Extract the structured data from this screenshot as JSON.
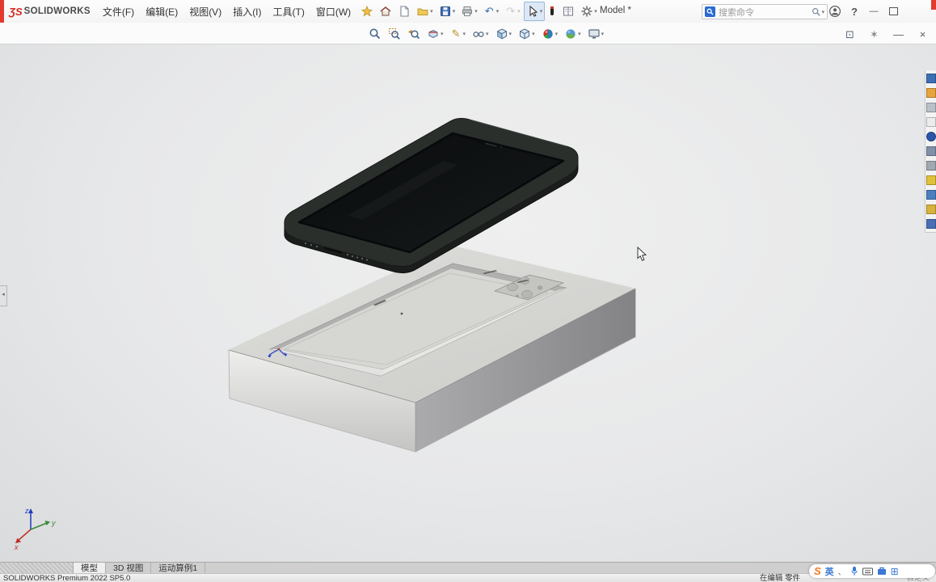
{
  "window": {
    "brand_mark": "ƷS",
    "brand": "SOLIDWORKS",
    "title": "Model *",
    "search_placeholder": "搜索命令",
    "help_label": "?",
    "minimize_glyph": "—"
  },
  "menus": {
    "items": [
      "文件(F)",
      "编辑(E)",
      "视图(V)",
      "插入(I)",
      "工具(T)",
      "窗口(W)"
    ]
  },
  "toolbar_main": {
    "icons": [
      {
        "name": "pin-toolbar-icon",
        "kind": "star"
      },
      {
        "name": "home-icon",
        "kind": "home"
      },
      {
        "name": "new-document-icon",
        "kind": "doc"
      },
      {
        "name": "open-document-icon",
        "kind": "folder",
        "dropdown": true
      },
      {
        "name": "save-icon",
        "kind": "save",
        "dropdown": true
      },
      {
        "name": "print-icon",
        "kind": "print",
        "dropdown": true
      },
      {
        "name": "undo-icon",
        "kind": "glyph",
        "glyph": "↶",
        "color": "#3a6db2",
        "dropdown": true
      },
      {
        "name": "redo-icon",
        "kind": "glyph",
        "glyph": "↷",
        "color": "#9a9a9a",
        "dropdown": true,
        "disabled": true
      },
      {
        "name": "select-cursor-icon",
        "kind": "cursor",
        "dropdown": true,
        "selected": true
      },
      {
        "name": "touch-pen-icon",
        "kind": "pen"
      },
      {
        "name": "report-icon",
        "kind": "book"
      },
      {
        "name": "options-gear-icon",
        "kind": "gear",
        "dropdown": true
      }
    ]
  },
  "toolbar_view": {
    "icons": [
      {
        "name": "zoom-fit-icon",
        "kind": "mag"
      },
      {
        "name": "zoom-area-icon",
        "kind": "magarea"
      },
      {
        "name": "previous-view-icon",
        "kind": "magprev"
      },
      {
        "name": "section-view-icon",
        "kind": "section",
        "dropdown": true
      },
      {
        "name": "sketch-pencil-icon",
        "kind": "glyph",
        "glyph": "✎",
        "color": "#b8912a",
        "dropdown": true
      },
      {
        "name": "hide-show-items-icon",
        "kind": "glasses",
        "dropdown": true
      },
      {
        "name": "display-style-icon",
        "kind": "cube2",
        "dropdown": true
      },
      {
        "name": "view-orientation-icon",
        "kind": "cube",
        "dropdown": true
      },
      {
        "name": "edit-appearance-icon",
        "kind": "ball",
        "dropdown": true
      },
      {
        "name": "apply-scene-icon",
        "kind": "ball2",
        "dropdown": true
      },
      {
        "name": "view-settings-icon",
        "kind": "monitor",
        "dropdown": true
      }
    ]
  },
  "doc_controls": {
    "icons": [
      {
        "name": "expand-pane-icon",
        "kind": "glyph",
        "glyph": "⊡",
        "color": "#5a6a7a"
      },
      {
        "name": "pin-pane-icon",
        "kind": "glyph",
        "glyph": "✶",
        "color": "#8a8a8a"
      },
      {
        "name": "minimize-doc-icon",
        "kind": "glyph",
        "glyph": "—",
        "color": "#5a5a5a"
      },
      {
        "name": "close-doc-icon",
        "kind": "glyph",
        "glyph": "×",
        "color": "#5a5a5a"
      }
    ]
  },
  "taskpane": {
    "icons": [
      {
        "name": "taskpane-resources-icon",
        "color": "#3a6fb5",
        "shape": "square"
      },
      {
        "name": "taskpane-design-library-icon",
        "color": "#e8a33c",
        "shape": "square"
      },
      {
        "name": "taskpane-file-explorer-icon",
        "color": "#b8c0c8",
        "shape": "square"
      },
      {
        "name": "taskpane-view-palette-icon",
        "color": "#ececec",
        "shape": "square"
      },
      {
        "name": "taskpane-appearances-icon",
        "color": "#2a55a8",
        "shape": "circle"
      },
      {
        "name": "taskpane-properties-icon",
        "color": "#8090a8",
        "shape": "square"
      },
      {
        "name": "taskpane-forum-icon",
        "color": "#a0a8b0",
        "shape": "square"
      },
      {
        "name": "taskpane-yellow-icon",
        "color": "#e0c23a",
        "shape": "square"
      },
      {
        "name": "taskpane-blue-icon",
        "color": "#4a7fc0",
        "shape": "square"
      },
      {
        "name": "taskpane-split-icon",
        "color": "#d8b23c",
        "shape": "square"
      },
      {
        "name": "taskpane-grid-icon",
        "color": "#4a6fb5",
        "shape": "square"
      }
    ]
  },
  "viewport": {
    "triad": {
      "x_label": "x",
      "y_label": "y",
      "z_label": "z"
    }
  },
  "tabs": {
    "items": [
      {
        "label": "模型",
        "active": true
      },
      {
        "label": "3D 视图",
        "active": false
      },
      {
        "label": "运动算例1",
        "active": false
      }
    ]
  },
  "statusbar": {
    "product": "SOLIDWORKS Premium 2022 SP5.0",
    "editing": "在编辑 零件",
    "customize": "自定义"
  },
  "ime": {
    "logo": "S",
    "lang": "英",
    "punct": "、",
    "grid": "⊞"
  }
}
